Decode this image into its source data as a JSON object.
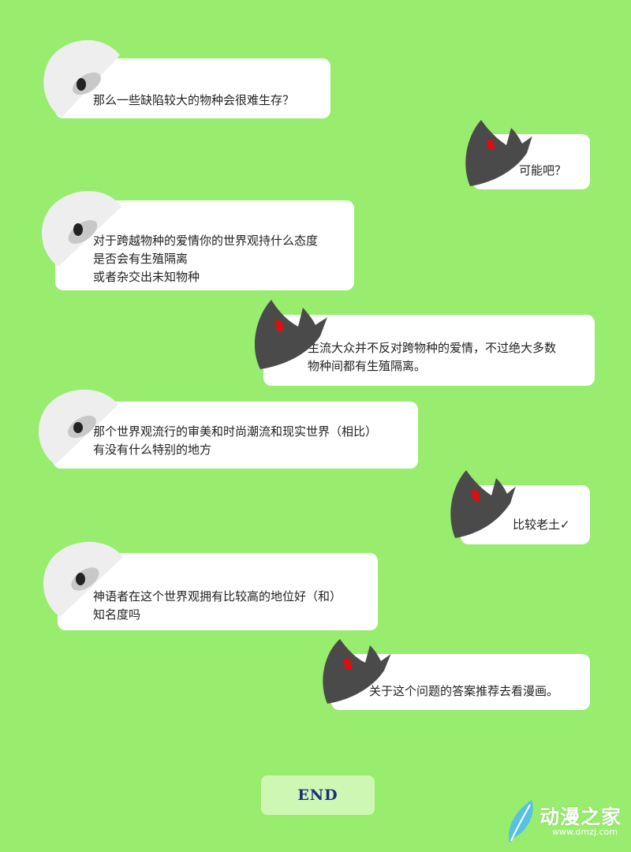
{
  "messages": [
    {
      "id": 1,
      "speaker": "white",
      "text": "那么一些缺陷较大的物种会很难生存？"
    },
    {
      "id": 2,
      "speaker": "dark",
      "text": "可能吧？"
    },
    {
      "id": 3,
      "speaker": "white",
      "text": "对于跨越物种的爱情你的世界观持什么态度\n是否会有生殖隔离\n或者杂交出未知物种"
    },
    {
      "id": 4,
      "speaker": "dark",
      "text": "主流大众并不反对跨物种的爱情，不过绝大多数\n物种间都有生殖隔离。"
    },
    {
      "id": 5,
      "speaker": "white",
      "text": "那个世界观流行的审美和时尚潮流和现实世界（相比）\n有没有什么特别的地方"
    },
    {
      "id": 6,
      "speaker": "dark",
      "text": "比较老土✓"
    },
    {
      "id": 7,
      "speaker": "white",
      "text": "神语者在这个世界观拥有比较高的地位好（和）\n知名度吗"
    },
    {
      "id": 8,
      "speaker": "dark",
      "text": "关于这个问题的答案推荐去看漫画。"
    }
  ],
  "end_button": {
    "label": "END"
  },
  "watermark": {
    "name": "动漫之家",
    "url": "www.dmzj.com"
  },
  "colors": {
    "background": "#98ec6e",
    "bubble": "#ffffff",
    "dark_avatar": "#4a4a4a",
    "dark_eye": "#d41212",
    "white_avatar": "#eeeeee"
  }
}
